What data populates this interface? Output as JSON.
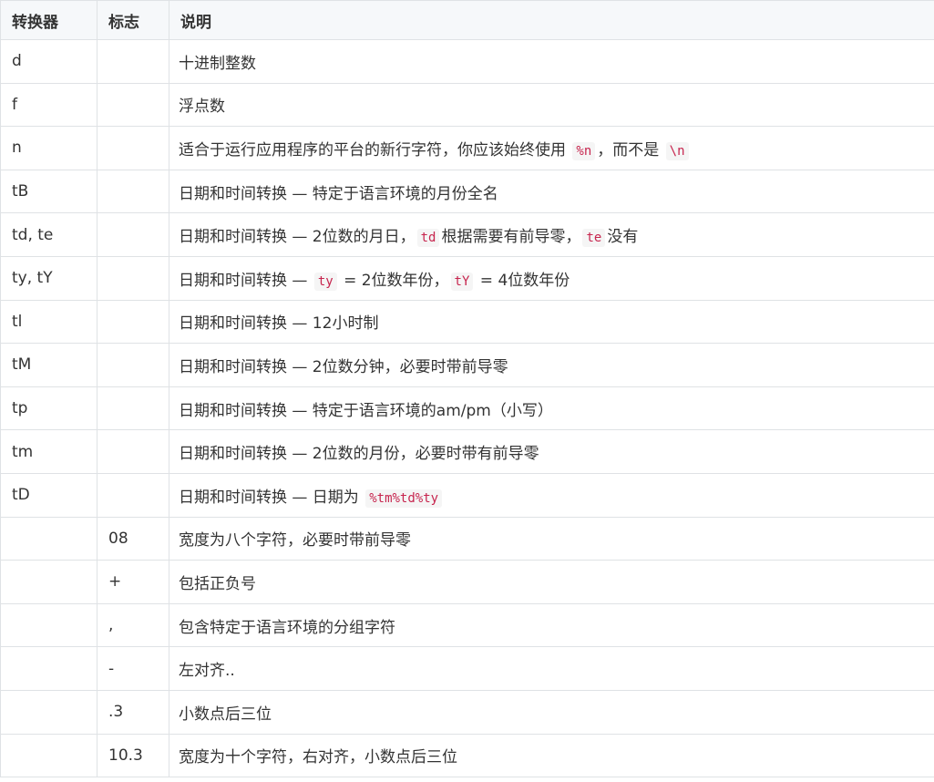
{
  "table": {
    "headers": [
      "转换器",
      "标志",
      "说明"
    ],
    "rows": [
      {
        "conv": "d",
        "flag": "",
        "desc": [
          {
            "t": "十进制整数"
          }
        ]
      },
      {
        "conv": "f",
        "flag": "",
        "desc": [
          {
            "t": "浮点数"
          }
        ]
      },
      {
        "conv": "n",
        "flag": "",
        "desc": [
          {
            "t": "适合于运行应用程序的平台的新行字符，你应该始终使用 "
          },
          {
            "c": "%n"
          },
          {
            "t": "，而不是 "
          },
          {
            "c": "\\n"
          }
        ]
      },
      {
        "conv": "tB",
        "flag": "",
        "desc": [
          {
            "t": "日期和时间转换 — 特定于语言环境的月份全名"
          }
        ]
      },
      {
        "conv": "td, te",
        "flag": "",
        "desc": [
          {
            "t": "日期和时间转换 — 2位数的月日，"
          },
          {
            "c": "td"
          },
          {
            "t": "根据需要有前导零，"
          },
          {
            "c": "te"
          },
          {
            "t": "没有"
          }
        ]
      },
      {
        "conv": "ty, tY",
        "flag": "",
        "desc": [
          {
            "t": "日期和时间转换 — "
          },
          {
            "c": "ty"
          },
          {
            "t": " = 2位数年份，"
          },
          {
            "c": "tY"
          },
          {
            "t": " = 4位数年份"
          }
        ]
      },
      {
        "conv": "tl",
        "flag": "",
        "desc": [
          {
            "t": "日期和时间转换 — 12小时制"
          }
        ]
      },
      {
        "conv": "tM",
        "flag": "",
        "desc": [
          {
            "t": "日期和时间转换 — 2位数分钟，必要时带前导零"
          }
        ]
      },
      {
        "conv": "tp",
        "flag": "",
        "desc": [
          {
            "t": "日期和时间转换 — 特定于语言环境的am/pm（小写）"
          }
        ]
      },
      {
        "conv": "tm",
        "flag": "",
        "desc": [
          {
            "t": "日期和时间转换 — 2位数的月份，必要时带有前导零"
          }
        ]
      },
      {
        "conv": "tD",
        "flag": "",
        "desc": [
          {
            "t": "日期和时间转换 — 日期为 "
          },
          {
            "c": "%tm%td%ty"
          }
        ]
      },
      {
        "conv": "",
        "flag": "08",
        "desc": [
          {
            "t": "宽度为八个字符，必要时带前导零"
          }
        ]
      },
      {
        "conv": "",
        "flag": "+",
        "desc": [
          {
            "t": "包括正负号"
          }
        ]
      },
      {
        "conv": "",
        "flag": ",",
        "desc": [
          {
            "t": "包含特定于语言环境的分组字符"
          }
        ]
      },
      {
        "conv": "",
        "flag": "-",
        "desc": [
          {
            "t": "左对齐.."
          }
        ]
      },
      {
        "conv": "",
        "flag": ".3",
        "desc": [
          {
            "t": "小数点后三位"
          }
        ]
      },
      {
        "conv": "",
        "flag": "10.3",
        "desc": [
          {
            "t": "宽度为十个字符，右对齐，小数点后三位"
          }
        ]
      }
    ]
  }
}
